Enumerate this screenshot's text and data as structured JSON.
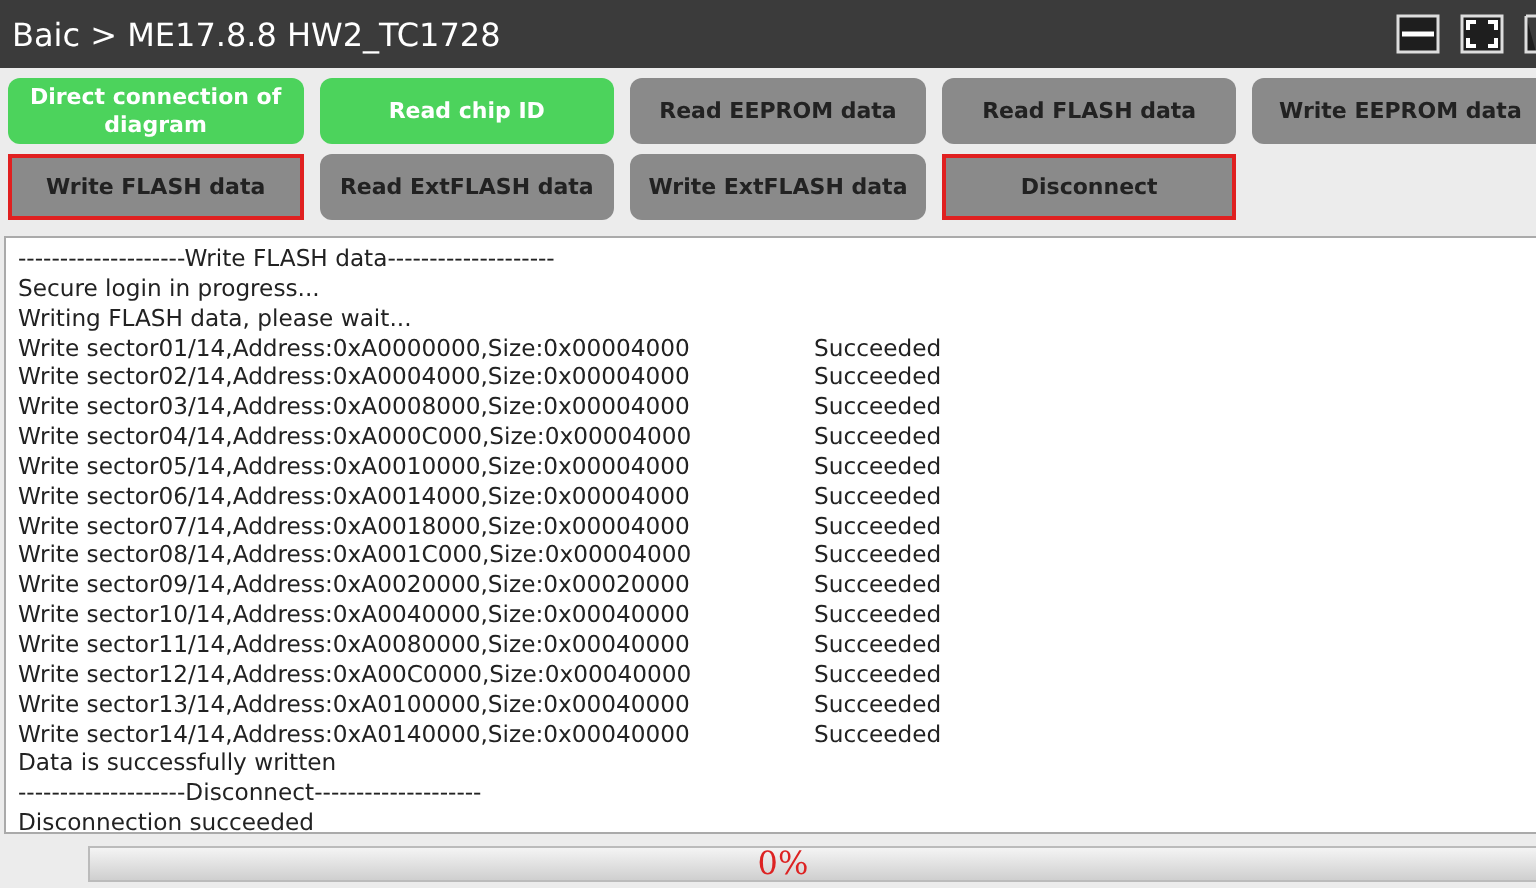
{
  "window": {
    "title": "Baic > ME17.8.8 HW2_TC1728"
  },
  "buttons": [
    {
      "label": "Direct connection of diagram",
      "color": "#4cd35c",
      "outlined": false
    },
    {
      "label": "Read chip ID",
      "color": "#4cd35c",
      "outlined": false
    },
    {
      "label": "Read EEPROM data",
      "color": "#8a8a8a",
      "outlined": false
    },
    {
      "label": "Read FLASH data",
      "color": "#8a8a8a",
      "outlined": false
    },
    {
      "label": "Write EEPROM data",
      "color": "#8a8a8a",
      "outlined": false
    },
    {
      "label": "Write FLASH data",
      "color": "#8a8a8a",
      "outlined": true
    },
    {
      "label": "Read ExtFLASH data",
      "color": "#8a8a8a",
      "outlined": false
    },
    {
      "label": "Write ExtFLASH data",
      "color": "#8a8a8a",
      "outlined": false
    },
    {
      "label": "Disconnect",
      "color": "#8a8a8a",
      "outlined": true
    }
  ],
  "log": [
    {
      "text": "--------------------Write FLASH data--------------------"
    },
    {
      "text": "Secure login in progress..."
    },
    {
      "text": "Writing FLASH data, please wait..."
    },
    {
      "text": "Write sector01/14,Address:0xA0000000,Size:0x00004000",
      "status": "Succeeded"
    },
    {
      "text": "Write sector02/14,Address:0xA0004000,Size:0x00004000",
      "status": "Succeeded"
    },
    {
      "text": "Write sector03/14,Address:0xA0008000,Size:0x00004000",
      "status": "Succeeded"
    },
    {
      "text": "Write sector04/14,Address:0xA000C000,Size:0x00004000",
      "status": "Succeeded"
    },
    {
      "text": "Write sector05/14,Address:0xA0010000,Size:0x00004000",
      "status": "Succeeded"
    },
    {
      "text": "Write sector06/14,Address:0xA0014000,Size:0x00004000",
      "status": "Succeeded"
    },
    {
      "text": "Write sector07/14,Address:0xA0018000,Size:0x00004000",
      "status": "Succeeded"
    },
    {
      "text": "Write sector08/14,Address:0xA001C000,Size:0x00004000",
      "status": "Succeeded"
    },
    {
      "text": "Write sector09/14,Address:0xA0020000,Size:0x00020000",
      "status": "Succeeded"
    },
    {
      "text": "Write sector10/14,Address:0xA0040000,Size:0x00040000",
      "status": "Succeeded"
    },
    {
      "text": "Write sector11/14,Address:0xA0080000,Size:0x00040000",
      "status": "Succeeded"
    },
    {
      "text": "Write sector12/14,Address:0xA00C0000,Size:0x00040000",
      "status": "Succeeded"
    },
    {
      "text": "Write sector13/14,Address:0xA0100000,Size:0x00040000",
      "status": "Succeeded"
    },
    {
      "text": "Write sector14/14,Address:0xA0140000,Size:0x00040000",
      "status": "Succeeded"
    },
    {
      "text": "Data is successfully written"
    },
    {
      "text": "--------------------Disconnect--------------------"
    },
    {
      "text": "Disconnection succeeded"
    }
  ],
  "progress": {
    "level": 0,
    "reading": "0%"
  }
}
